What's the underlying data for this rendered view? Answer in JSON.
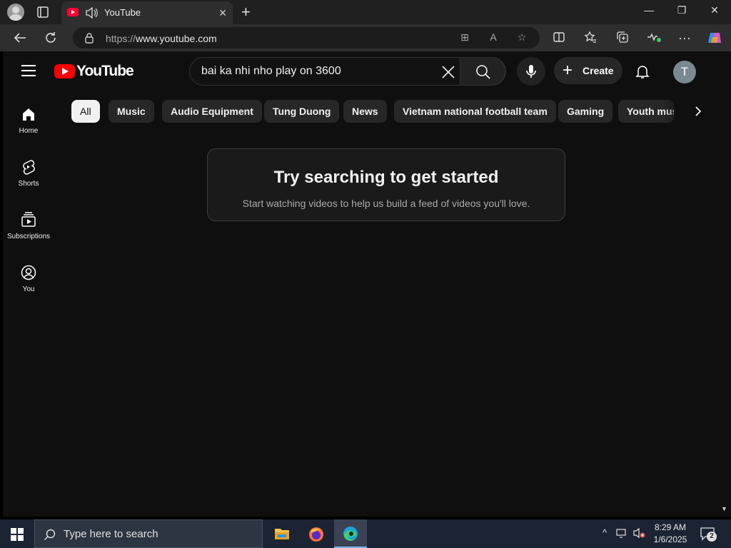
{
  "browser": {
    "tab": {
      "title": "YouTube"
    },
    "address": {
      "url_prefix": "https://",
      "url_host": "www.youtube.com"
    }
  },
  "header": {
    "logo_text": "YouTube",
    "search": {
      "query": "bai ka nhi nho play on 3600"
    },
    "create_label": "Create",
    "avatar_letter": "T"
  },
  "sidebar": {
    "items": [
      {
        "label": "Home",
        "icon": "home-icon"
      },
      {
        "label": "Shorts",
        "icon": "shorts-icon"
      },
      {
        "label": "Subscriptions",
        "icon": "subscriptions-icon"
      },
      {
        "label": "You",
        "icon": "you-icon"
      }
    ]
  },
  "chips": [
    {
      "label": "All",
      "active": true
    },
    {
      "label": "Music"
    },
    {
      "label": "Audio Equipment"
    },
    {
      "label": "Tung Duong"
    },
    {
      "label": "News"
    },
    {
      "label": "Vietnam national football team"
    },
    {
      "label": "Gaming"
    },
    {
      "label": "Youth music"
    }
  ],
  "empty_state": {
    "heading": "Try searching to get started",
    "text": "Start watching videos to help us build a feed of videos you'll love."
  },
  "taskbar": {
    "search_placeholder": "Type here to search",
    "time": "8:29 AM",
    "date": "1/6/2025",
    "notification_count": "2"
  },
  "colors": {
    "page_bg": "#0f0f0f",
    "youtube_red": "#ff0000",
    "chip_bg": "#272727",
    "chip_active_bg": "#f1f1f1"
  }
}
